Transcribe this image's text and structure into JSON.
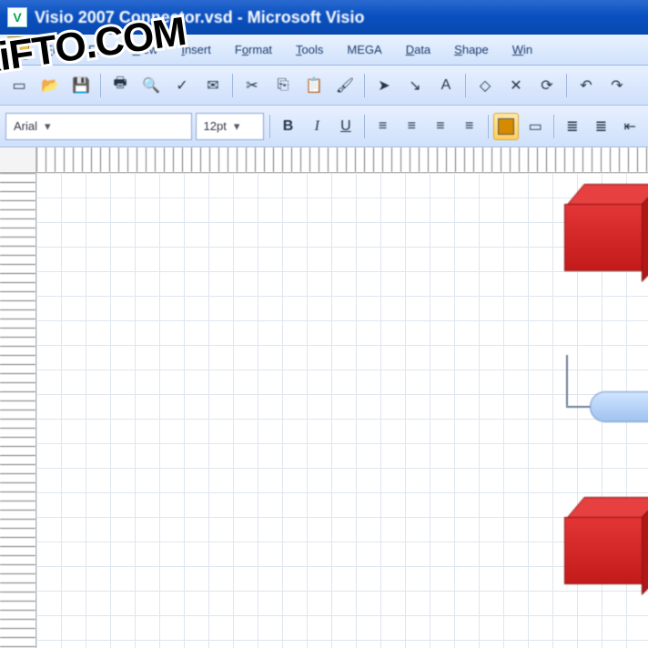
{
  "watermark_text": "XiFTO.COM",
  "titlebar": {
    "title": "Visio 2007 Connector.vsd - Microsoft Visio"
  },
  "menu": {
    "items": [
      "File",
      "Edit",
      "View",
      "Insert",
      "Format",
      "Tools",
      "MEGA",
      "Data",
      "Shape",
      "Window"
    ]
  },
  "toolbar_std": {
    "buttons": [
      "new",
      "open",
      "save",
      "print",
      "preview",
      "spell",
      "mail",
      "cut",
      "copy",
      "paste",
      "brush",
      "undo",
      "redo",
      "pointer",
      "connector",
      "text",
      "zoom"
    ]
  },
  "font_row": {
    "font_name": "Arial",
    "font_size": "12pt",
    "style_buttons": [
      "bold",
      "italic",
      "underline"
    ],
    "align_buttons": [
      "align-left",
      "align-center",
      "align-right",
      "justify"
    ],
    "fill_label": "fill-color",
    "list_buttons": [
      "bullets",
      "numbering",
      "decrease-indent"
    ]
  },
  "canvas": {
    "shapes": [
      {
        "type": "box3d",
        "name": "red-cube-top"
      },
      {
        "type": "pill",
        "name": "blue-pill-node"
      },
      {
        "type": "box3d",
        "name": "red-cube-bottom"
      }
    ]
  }
}
